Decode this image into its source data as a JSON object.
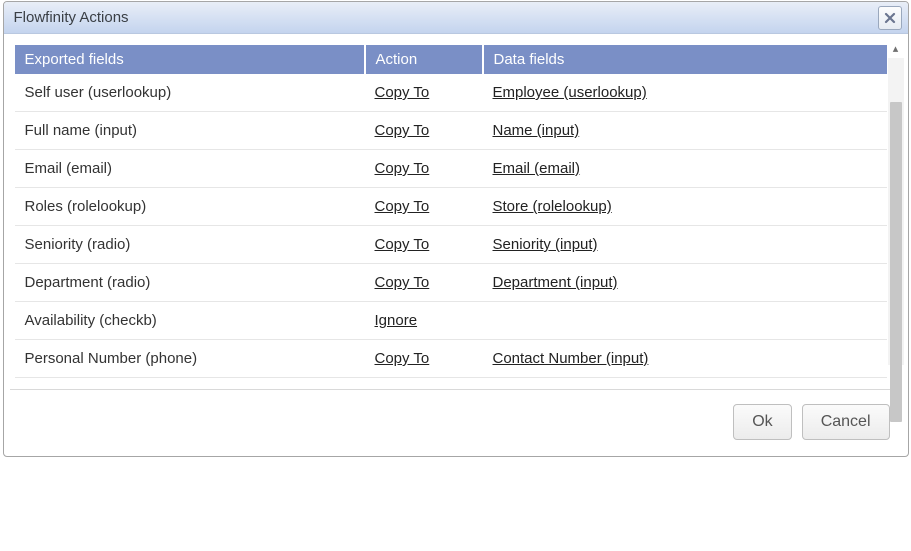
{
  "dialog": {
    "title": "Flowfinity Actions"
  },
  "table": {
    "headers": {
      "exported": "Exported fields",
      "action": "Action",
      "data": "Data fields"
    },
    "rows": [
      {
        "exported": "Self user (userlookup)",
        "action": "Copy To",
        "data": "Employee (userlookup)"
      },
      {
        "exported": "Full name (input)",
        "action": "Copy To",
        "data": "Name (input)"
      },
      {
        "exported": "Email (email)",
        "action": "Copy To",
        "data": "Email (email)"
      },
      {
        "exported": "Roles (rolelookup)",
        "action": "Copy To",
        "data": "Store (rolelookup)"
      },
      {
        "exported": "Seniority (radio)",
        "action": "Copy To",
        "data": "Seniority (input)"
      },
      {
        "exported": "Department (radio)",
        "action": "Copy To",
        "data": "Department (input)"
      },
      {
        "exported": "Availability (checkb)",
        "action": "Ignore",
        "data": ""
      },
      {
        "exported": "Personal Number (phone)",
        "action": "Copy To",
        "data": "Contact Number (input)"
      }
    ]
  },
  "footer": {
    "ok": "Ok",
    "cancel": "Cancel"
  }
}
